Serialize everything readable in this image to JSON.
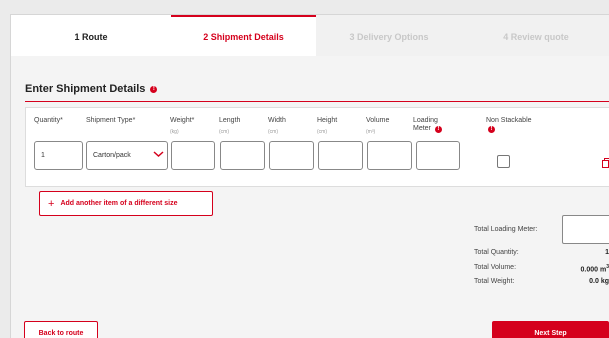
{
  "tabs": [
    {
      "label": "1 Route",
      "state": "completed"
    },
    {
      "label": "2 Shipment Details",
      "state": "active"
    },
    {
      "label": "3 Delivery Options",
      "state": "disabled"
    },
    {
      "label": "4 Review quote",
      "state": "disabled"
    }
  ],
  "section": {
    "title": "Enter Shipment Details",
    "info_icon": "!"
  },
  "item": {
    "columns": [
      {
        "label": "Quantity*",
        "unit": ""
      },
      {
        "label": "Shipment Type*",
        "unit": ""
      },
      {
        "label": "Weight*",
        "unit": "(kg)"
      },
      {
        "label": "Length",
        "unit": "(cm)"
      },
      {
        "label": "Width",
        "unit": "(cm)"
      },
      {
        "label": "Height",
        "unit": "(cm)"
      },
      {
        "label": "Volume",
        "unit": "(m³)"
      },
      {
        "label": "Loading Meter",
        "unit": ""
      },
      {
        "label": "Non Stackable",
        "unit": ""
      }
    ],
    "values": {
      "quantity": "1",
      "shipment_type": "Carton/pack",
      "weight": "",
      "length": "",
      "width": "",
      "height": "",
      "volume": "",
      "loading_meter": ""
    },
    "non_stackable_checked": false
  },
  "add_item_label": "Add another item of a different size",
  "totals": {
    "loading_meter_label": "Total Loading Meter:",
    "loading_meter_value": "",
    "quantity_label": "Total Quantity:",
    "quantity_value": "1",
    "volume_label": "Total Volume:",
    "volume_value": "0.000 m",
    "volume_unit_sup": "3",
    "weight_label": "Total Weight:",
    "weight_value": "0.0 kg"
  },
  "buttons": {
    "back": "Back to route",
    "next": "Next Step"
  },
  "icons": {
    "info": "info-icon",
    "chevron": "chevron-down-icon",
    "copy": "copy-icon",
    "plus": "plus-icon"
  },
  "colors": {
    "accent": "#d5001c",
    "background": "#f4f4f4",
    "card": "#ffffff"
  }
}
